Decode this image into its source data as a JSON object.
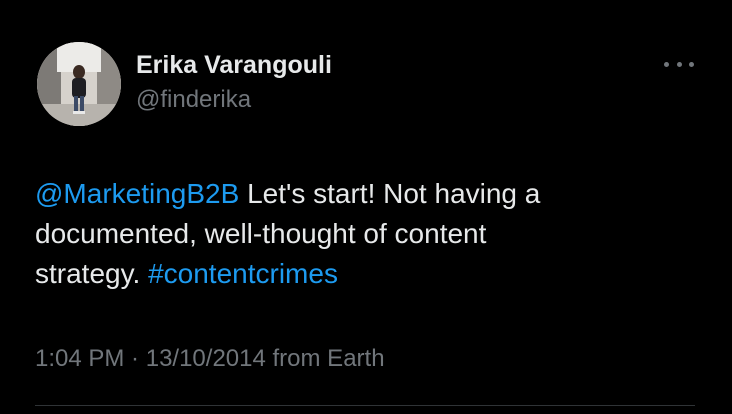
{
  "author": {
    "display_name": "Erika Varangouli",
    "handle": "@finderika"
  },
  "more_icon": "more-horizontal-icon",
  "tweet": {
    "mention": "@MarketingB2B",
    "text_line1": " Let's start! Not having a",
    "text_line2": "documented, well-thought of content",
    "text_line3": "strategy. ",
    "hashtag": "#contentcrimes"
  },
  "meta": {
    "time": "1:04 PM",
    "separator": " · ",
    "date": "13/10/2014",
    "source": " from Earth"
  },
  "colors": {
    "background": "#000000",
    "text": "#e7e9ea",
    "secondary": "#71767b",
    "link": "#1d9bf0"
  }
}
